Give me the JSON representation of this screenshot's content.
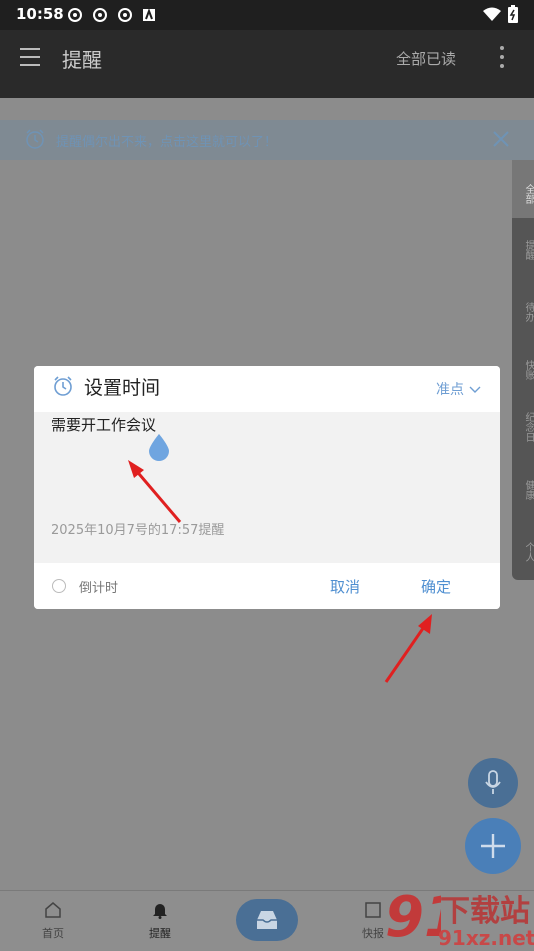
{
  "status_bar": {
    "time": "10:58"
  },
  "app_bar": {
    "title": "提醒",
    "read_all": "全部已读"
  },
  "notice": {
    "text": "提醒偶尔出不来，点击这里就可以了！"
  },
  "side_tabs": [
    "全部",
    "提醒",
    "待办",
    "快账",
    "纪念日",
    "健康",
    "个人"
  ],
  "dialog": {
    "title": "设置时间",
    "mode": "准点",
    "content": "需要开工作会议",
    "remind_time": "2025年10月7号的17:57提醒",
    "countdown_label": "倒计时",
    "cancel_label": "取消",
    "confirm_label": "确定"
  },
  "bottom_nav": {
    "home": "首页",
    "reminders": "提醒",
    "quick": "快报"
  },
  "watermark": {
    "text": "下载站",
    "url": "91xz.net",
    "logo": "91"
  },
  "colors": {
    "accent": "#4f8fd1",
    "annotation_arrow": "#e02020"
  }
}
